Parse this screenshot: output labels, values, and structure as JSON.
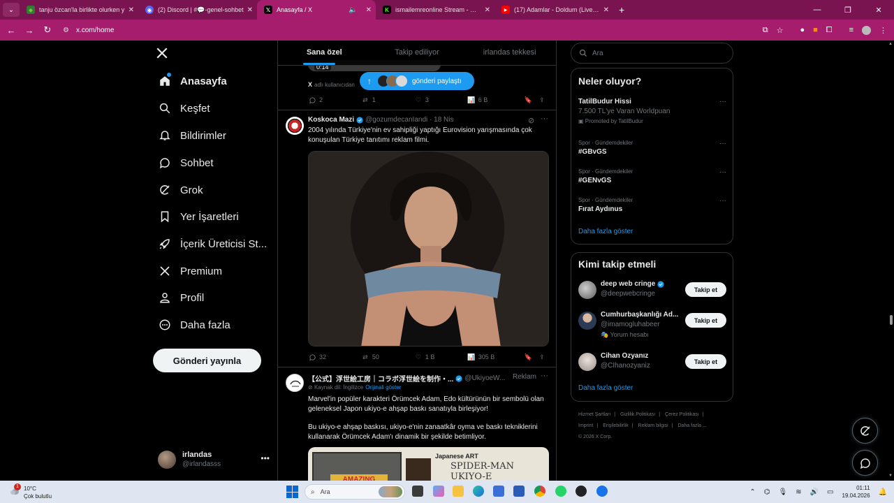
{
  "browser": {
    "tabs": [
      {
        "title": "tanju özcan'la birlikte olurken y",
        "favicon": "leaf-icon",
        "color": "#7cc242"
      },
      {
        "title": "(2) Discord | #💬-genel-sohbet",
        "favicon": "discord-icon",
        "color": "#5865f2"
      },
      {
        "title": "Anasayfa / X",
        "favicon": "x-icon",
        "color": "#000000",
        "active": true
      },
      {
        "title": "ismailemreonline Stream - Watc",
        "favicon": "kick-icon",
        "color": "#53fc18"
      },
      {
        "title": "(17) Adamlar - Doldum (Live Fro",
        "favicon": "youtube-icon",
        "color": "#ff0000"
      }
    ],
    "url": "x.com/home"
  },
  "nav": {
    "items": [
      {
        "label": "Anasayfa",
        "icon": "home-icon"
      },
      {
        "label": "Keşfet",
        "icon": "search-icon"
      },
      {
        "label": "Bildirimler",
        "icon": "bell-icon"
      },
      {
        "label": "Sohbet",
        "icon": "chat-icon"
      },
      {
        "label": "Grok",
        "icon": "grok-icon"
      },
      {
        "label": "Yer İşaretleri",
        "icon": "bookmark-icon"
      },
      {
        "label": "İçerik Üreticisi St...",
        "icon": "rocket-icon"
      },
      {
        "label": "Premium",
        "icon": "x-logo-icon"
      },
      {
        "label": "Profil",
        "icon": "person-icon"
      },
      {
        "label": "Daha fazla",
        "icon": "more-circle-icon"
      }
    ],
    "post_button": "Gönderi yayınla",
    "account": {
      "name": "irlandas",
      "handle": "@irlandasss"
    }
  },
  "feed": {
    "tabs": [
      "Sana özel",
      "Takip ediliyor",
      "irlandas tekkesi"
    ],
    "new_posts_pill": "gönderi paylaştı",
    "prev": {
      "time": "0:14",
      "source": "adlı kullanıcıdan",
      "replies": "2",
      "reposts": "1",
      "likes": "3",
      "views": "6 B"
    },
    "tweet1": {
      "name": "Koskoca Mazi",
      "handle": "@gozumdecanIandi",
      "time": "18 Nis",
      "text": "2004 yılında Türkiye'nin ev sahipliği yaptığı Eurovision yarışmasında çok konuşulan Türkiye tanıtımı reklam filmi.",
      "replies": "32",
      "reposts": "50",
      "likes": "1 B",
      "views": "305 B"
    },
    "tweet2": {
      "name": "【公式】浮世絵工房｜コラボ浮世絵を制作・...",
      "handle": "@UkiyoeW...",
      "ad": "Reklam",
      "translate": "Kaynak dil: İngilizce",
      "translate_link": "Orijinali göster",
      "text1": "Marvel'in popüler karakteri Örümcek Adam, Edo kültürünün bir sembolü olan geleneksel Japon ukiyo-e ahşap baskı sanatıyla birleşiyor!",
      "text2": "Bu ukiyo-e ahşap baskısı, ukiyo-e'nin zanaatkâr oyma ve baskı tekniklerini kullanarak Örümcek Adam'ı dinamik bir şekilde betimliyor.",
      "media_label1": "Japanese ART",
      "media_label2": "SPIDER-MAN UKIYO-E",
      "media_label3": "AMAZING"
    }
  },
  "right": {
    "search_placeholder": "Ara",
    "trends_title": "Neler oluyor?",
    "trends": [
      {
        "category": "",
        "title": "TatilBudur Hissi",
        "sub": "7.500 TL'ye Varan Worldpuan",
        "promo": "Promoted by TatilBudur"
      },
      {
        "category": "Spor · Gündemdekiler",
        "title": "#GBvGS"
      },
      {
        "category": "Spor · Gündemdekiler",
        "title": "#GENvGS"
      },
      {
        "category": "Spor · Gündemdekiler",
        "title": "Fırat Aydınus"
      }
    ],
    "trends_more": "Daha fazla göster",
    "wtf_title": "Kimi takip etmeli",
    "wtf": [
      {
        "name": "deep web cringe",
        "handle": "@deepwebcringe",
        "verified": true
      },
      {
        "name": "Cumhurbaşkanlığı Ad...",
        "handle": "@imamogluhabeer",
        "extra": "Yorum hesabı"
      },
      {
        "name": "Cihan Özyanız",
        "handle": "@CIhanozyaniz"
      }
    ],
    "follow_label": "Takip et",
    "wtf_more": "Daha fazla göster",
    "footer": [
      "Hizmet Şartları",
      "Gizlilik Politikası",
      "Çerez Politikası",
      "Imprint",
      "Erişilebilirlik",
      "Reklam bilgisi",
      "Daha fazla ...",
      "© 2026 X Corp."
    ]
  },
  "taskbar": {
    "temp": "10°C",
    "condition": "Çok bulutlu",
    "badge": "1",
    "search_placeholder": "Ara",
    "time": "01:11",
    "date": "19.04.2026"
  },
  "colors": {
    "accent": "#1d9bf0",
    "chrome": "#a51d6c"
  }
}
